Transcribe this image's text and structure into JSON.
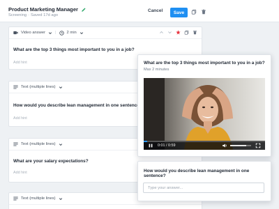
{
  "header": {
    "title": "Product Marketing Manager",
    "status": "Screening",
    "dot": "·",
    "saved": "Saved 17d ago",
    "cancel_label": "Cancel",
    "save_label": "Save"
  },
  "questions": [
    {
      "type_label": "Video answer",
      "duration": "2 min",
      "question": "What are the top 3 things most important to you in a job?",
      "hint": "Add hint"
    },
    {
      "type_label": "Text (multiple lines)",
      "question": "How would you describe lean management in one sentence?",
      "hint": "Add hint"
    },
    {
      "type_label": "Text (multiple lines)",
      "question": "What are your salary expectations?",
      "hint": "Add hint"
    },
    {
      "type_label": "Text (multiple lines)"
    }
  ],
  "preview_video": {
    "question": "What are the top 3 things most important to you in a job?",
    "max_label": "Max 2 minutes",
    "time": "0:01 / 0:59",
    "progress": 0.03,
    "volume": 0.75
  },
  "preview_text": {
    "question": "How would you describe lean management in one sentence?",
    "placeholder": "Type your answer..."
  },
  "colors": {
    "accent": "#1f8ff2",
    "star": "#e8343f",
    "pencil": "#2fa86a"
  },
  "icons": [
    "pencil-icon",
    "copy-icon",
    "trash-icon",
    "video-camera-icon",
    "clock-icon",
    "chevron-down-icon",
    "chevron-up-icon",
    "star-icon",
    "text-lines-icon",
    "drag-handle-icon",
    "play-pause-icon",
    "volume-icon",
    "fullscreen-icon",
    "more-icon"
  ]
}
